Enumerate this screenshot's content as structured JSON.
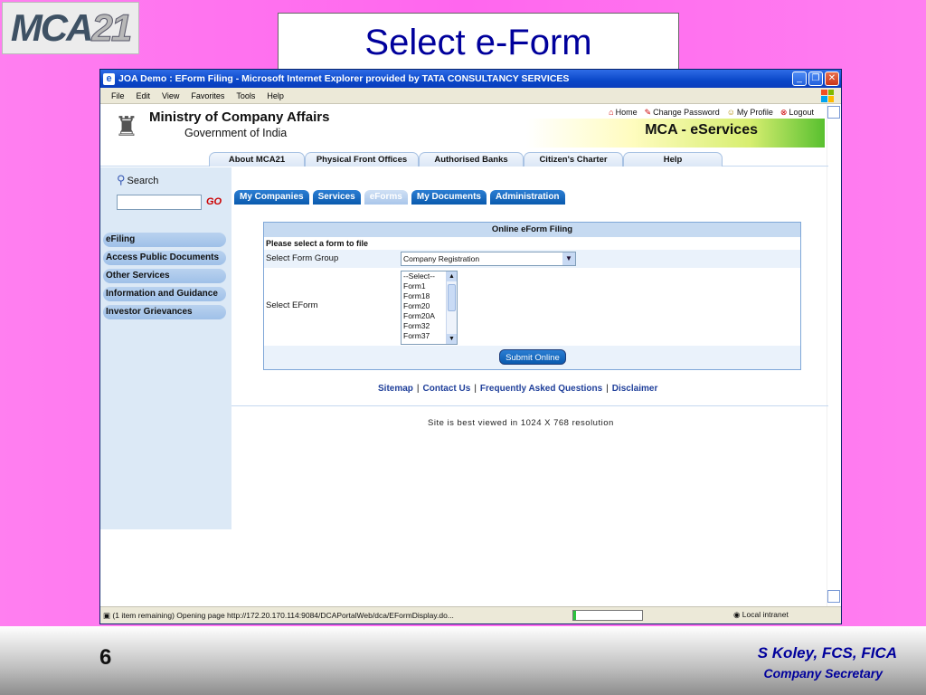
{
  "slide": {
    "logo_main": "MCA",
    "logo_num": "21",
    "title": "Select e-Form",
    "page_number": "6",
    "author": "S Koley, FCS, FICA",
    "role": "Company Secretary"
  },
  "window": {
    "title": "JOA Demo  : EForm Filing - Microsoft Internet Explorer provided by TATA CONSULTANCY SERVICES",
    "menu": [
      "File",
      "Edit",
      "View",
      "Favorites",
      "Tools",
      "Help"
    ]
  },
  "header": {
    "ministry": "Ministry of Company Affairs",
    "government": "Government of India",
    "eservices": "MCA - eServices",
    "links": {
      "home": "Home",
      "change_password": "Change Password",
      "my_profile": "My Profile",
      "logout": "Logout"
    }
  },
  "nav_tabs": [
    "About MCA21",
    "Physical Front Offices",
    "Authorised Banks",
    "Citizen's Charter",
    "Help"
  ],
  "sidebar": {
    "search_label": "Search",
    "go_label": "GO",
    "items": [
      "eFiling",
      "Access Public Documents",
      "Other Services",
      "Information and Guidance",
      "Investor Grievances"
    ]
  },
  "subtabs": [
    "My Companies",
    "Services",
    "eForms",
    "My Documents",
    "Administration"
  ],
  "form": {
    "heading": "Online eForm Filing",
    "instruction": "Please select a form to file",
    "group_label": "Select Form Group",
    "group_value": "Company Registration",
    "eform_label": "Select EForm",
    "eform_options": [
      "--Select--",
      "Form1",
      "Form18",
      "Form20",
      "Form20A",
      "Form32",
      "Form37"
    ],
    "submit_label": "Submit Online"
  },
  "footer": {
    "links": [
      "Sitemap",
      "Contact Us",
      "Frequently Asked Questions",
      "Disclaimer"
    ],
    "best_view": "Site is best viewed in 1024 X 768 resolution"
  },
  "status": {
    "message": "(1 item remaining) Opening page http://172.20.170.114:9084/DCAPortalWeb/dca/EFormDisplay.do...",
    "zone": "Local intranet"
  },
  "colors": {
    "slide_bg": "#ff66ee",
    "title_text": "#00009c",
    "tab_blue": "#0a5aae"
  }
}
